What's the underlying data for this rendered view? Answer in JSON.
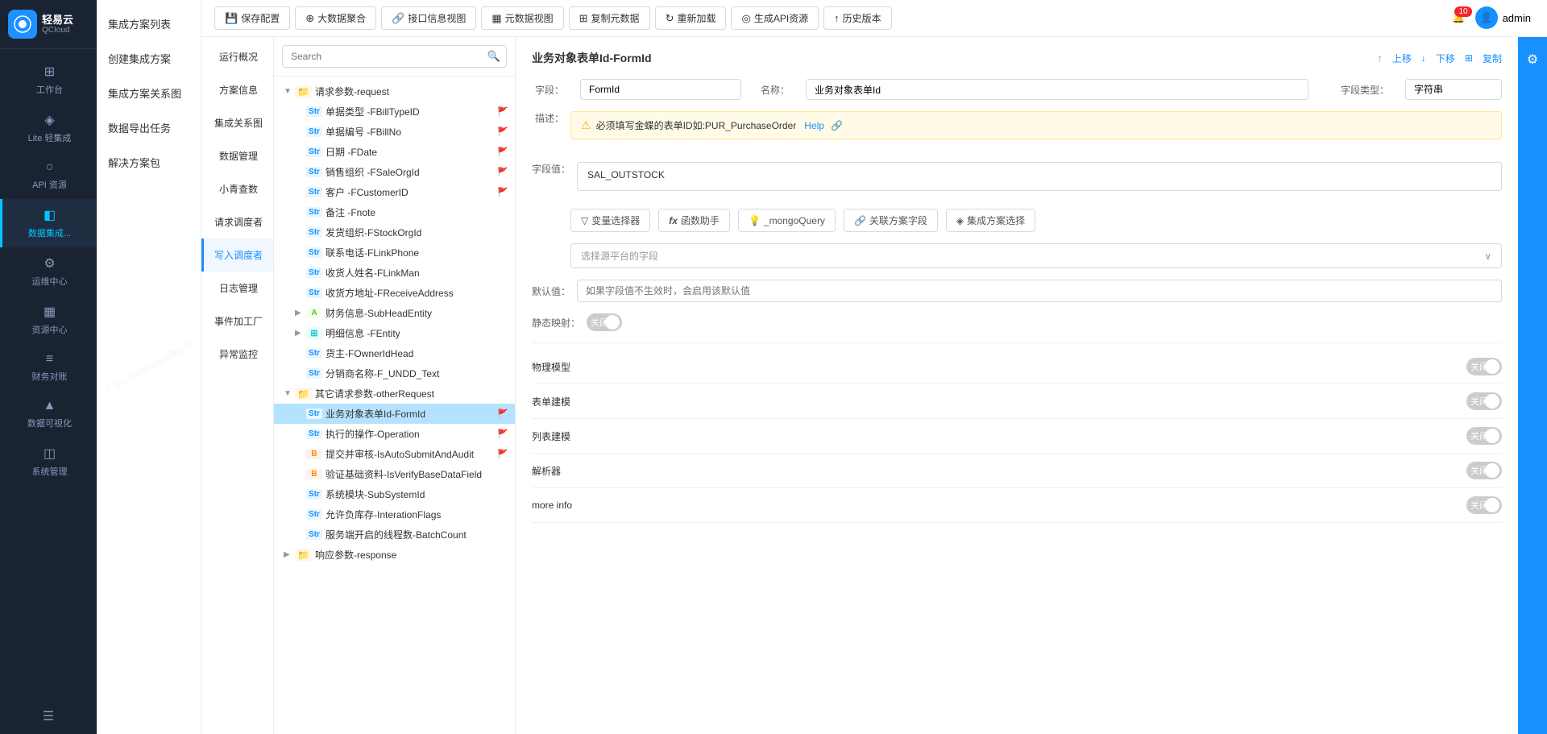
{
  "app": {
    "logo_text": "轻易云",
    "logo_sub": "QCIoud",
    "notification_count": "10",
    "user_name": "admin"
  },
  "sidebar": {
    "items": [
      {
        "id": "workbench",
        "label": "工作台",
        "icon": "⊞"
      },
      {
        "id": "lite",
        "label": "Lite 轻集成",
        "icon": "◈"
      },
      {
        "id": "api",
        "label": "API 资源",
        "icon": "○"
      },
      {
        "id": "data",
        "label": "数据集成...",
        "icon": "◧",
        "active": true
      },
      {
        "id": "ops",
        "label": "运维中心",
        "icon": "⚙"
      },
      {
        "id": "resource",
        "label": "资源中心",
        "icon": "▦"
      },
      {
        "id": "finance",
        "label": "财务对账",
        "icon": "≡"
      },
      {
        "id": "visual",
        "label": "数据可视化",
        "icon": "▲"
      },
      {
        "id": "system",
        "label": "系统管理",
        "icon": "◫"
      }
    ]
  },
  "sidebar2": {
    "items": [
      "集成方案列表",
      "创建集成方案",
      "集成方案关系图",
      "数据导出任务",
      "解决方案包"
    ]
  },
  "panel3": {
    "items": [
      {
        "id": "overview",
        "label": "运行概况"
      },
      {
        "id": "info",
        "label": "方案信息"
      },
      {
        "id": "relation",
        "label": "集成关系图"
      },
      {
        "id": "data",
        "label": "数据管理"
      },
      {
        "id": "small",
        "label": "小青查数"
      },
      {
        "id": "write",
        "label": "写入调度者",
        "active": true
      },
      {
        "id": "log",
        "label": "日志管理"
      },
      {
        "id": "event",
        "label": "事件加工厂"
      },
      {
        "id": "exception",
        "label": "异常监控"
      }
    ]
  },
  "toolbar": {
    "buttons": [
      {
        "id": "save",
        "icon": "💾",
        "label": "保存配置"
      },
      {
        "id": "bigdata",
        "icon": "⊕",
        "label": "大数据聚合"
      },
      {
        "id": "api_view",
        "icon": "🔗",
        "label": "接口信息视图"
      },
      {
        "id": "meta_view",
        "icon": "▦",
        "label": "元数据视图"
      },
      {
        "id": "copy_data",
        "icon": "⊞",
        "label": "复制元数据"
      },
      {
        "id": "reload",
        "icon": "↻",
        "label": "重新加载"
      },
      {
        "id": "gen_api",
        "icon": "◎",
        "label": "生成API资源"
      },
      {
        "id": "history",
        "icon": "↑",
        "label": "历史版本"
      }
    ]
  },
  "tree": {
    "search_placeholder": "Search",
    "nodes": [
      {
        "id": "req",
        "level": 0,
        "type": "folder",
        "label": "请求参数-request",
        "expanded": true,
        "indent": 0
      },
      {
        "id": "billtype",
        "level": 1,
        "type": "str",
        "label": "单据类型 -FBillTypeID",
        "flag": true,
        "indent": 1
      },
      {
        "id": "billno",
        "level": 1,
        "type": "str",
        "label": "单据编号 -FBillNo",
        "flag": true,
        "indent": 1
      },
      {
        "id": "date",
        "level": 1,
        "type": "str",
        "label": "日期 -FDate",
        "flag": true,
        "indent": 1
      },
      {
        "id": "saleorg",
        "level": 1,
        "type": "str",
        "label": "销售组织 -FSaleOrgId",
        "flag": true,
        "indent": 1
      },
      {
        "id": "customer",
        "level": 1,
        "type": "str",
        "label": "客户 -FCustomerID",
        "flag": true,
        "indent": 1
      },
      {
        "id": "note",
        "level": 1,
        "type": "str",
        "label": "备注 -Fnote",
        "indent": 1
      },
      {
        "id": "stockorg",
        "level": 1,
        "type": "str",
        "label": "发货组织-FStockOrgId",
        "indent": 1
      },
      {
        "id": "linkphone",
        "level": 1,
        "type": "str",
        "label": "联系电话-FLinkPhone",
        "indent": 1
      },
      {
        "id": "linkman",
        "level": 1,
        "type": "str",
        "label": "收货人姓名-FLinkMan",
        "indent": 1
      },
      {
        "id": "address",
        "level": 1,
        "type": "str",
        "label": "收货方地址-FReceiveAddress",
        "indent": 1
      },
      {
        "id": "finance",
        "level": 1,
        "type": "a",
        "label": "财务信息-SubHeadEntity",
        "expandable": true,
        "indent": 1
      },
      {
        "id": "detail",
        "level": 1,
        "type": "table",
        "label": "明细信息 -FEntity",
        "expandable": true,
        "indent": 1
      },
      {
        "id": "owner",
        "level": 1,
        "type": "str",
        "label": "货主-FOwnerIdHead",
        "indent": 1
      },
      {
        "id": "sale_name",
        "level": 1,
        "type": "str",
        "label": "分销商名称-F_UNDD_Text",
        "indent": 1
      },
      {
        "id": "other_req",
        "level": 0,
        "type": "folder",
        "label": "其它请求参数-otherRequest",
        "expanded": true,
        "indent": 0
      },
      {
        "id": "formid",
        "level": 1,
        "type": "str",
        "label": "业务对象表单Id-FormId",
        "selected": true,
        "flag": true,
        "indent": 1
      },
      {
        "id": "operation",
        "level": 1,
        "type": "str",
        "label": "执行的操作-Operation",
        "flag": true,
        "indent": 1
      },
      {
        "id": "autosubmit",
        "level": 1,
        "type": "b",
        "label": "提交并审核-IsAutoSubmitAndAudit",
        "flag": true,
        "indent": 1
      },
      {
        "id": "verify",
        "level": 1,
        "type": "b",
        "label": "验证基础资料-IsVerifyBaseDataField",
        "indent": 1
      },
      {
        "id": "subsystem",
        "level": 1,
        "type": "str",
        "label": "系统模块-SubSystemId",
        "indent": 1
      },
      {
        "id": "flags",
        "level": 1,
        "type": "str",
        "label": "允许负库存-InterationFlags",
        "indent": 1
      },
      {
        "id": "batchcount",
        "level": 1,
        "type": "str",
        "label": "服务端开启的线程数-BatchCount",
        "indent": 1
      },
      {
        "id": "response",
        "level": 0,
        "type": "folder",
        "label": "响应参数-response",
        "expanded": false,
        "indent": 0
      }
    ]
  },
  "detail": {
    "title": "业务对象表单Id-FormId",
    "actions": {
      "up": "上移",
      "down": "下移",
      "copy": "复制"
    },
    "field_label": "字段：",
    "field_value": "FormId",
    "name_label": "名称：",
    "name_value": "业务对象表单Id",
    "type_label": "字段类型：",
    "type_value": "字符串",
    "desc_label": "描述：",
    "desc_content": "必须填写金蝶的表单ID如:PUR_PurchaseOrder",
    "desc_help": "Help",
    "field_data_label": "字段值：",
    "field_data_value": "SAL_OUTSTOCK",
    "func_buttons": [
      {
        "id": "var",
        "icon": "▽",
        "label": "变量选择器"
      },
      {
        "id": "func",
        "icon": "fx",
        "label": "函数助手"
      },
      {
        "id": "mongo",
        "icon": "◎",
        "label": "_mongoQuery"
      },
      {
        "id": "assoc",
        "icon": "🔗",
        "label": "关联方案字段"
      },
      {
        "id": "integrate",
        "icon": "◈",
        "label": "集成方案选择"
      }
    ],
    "source_placeholder": "选择源平台的字段",
    "default_placeholder": "如果字段值不生效时，会启用该默认值",
    "default_label": "默认值：",
    "static_label": "静态映射：",
    "static_value": "关闭",
    "toggles": [
      {
        "id": "physical",
        "label": "物理模型",
        "value": "关闭"
      },
      {
        "id": "table",
        "label": "表单建模",
        "value": "关闭"
      },
      {
        "id": "list",
        "label": "列表建模",
        "value": "关闭"
      },
      {
        "id": "parser",
        "label": "解析器",
        "value": "关闭"
      },
      {
        "id": "moreinfo",
        "label": "more info",
        "value": "关闭"
      }
    ]
  },
  "colors": {
    "primary": "#1890ff",
    "active_bg": "#e6f7ff",
    "highlight_bg": "#b5e3ff",
    "danger": "#f5222d",
    "warning": "#faad14",
    "sidebar_bg": "#1a2332"
  }
}
